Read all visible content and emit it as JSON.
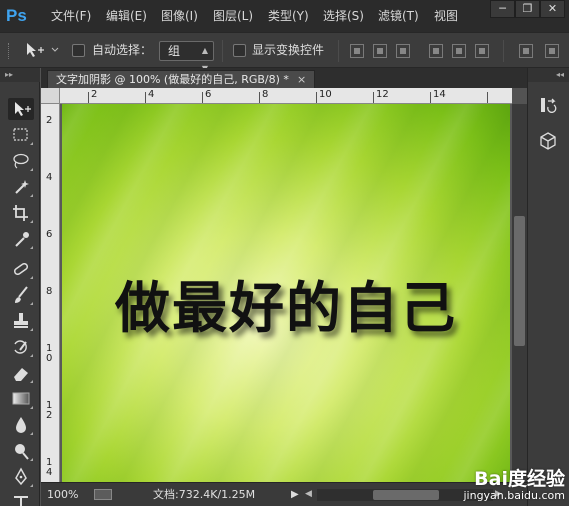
{
  "app": {
    "logo": "Ps"
  },
  "menu": {
    "items": [
      "文件(F)",
      "编辑(E)",
      "图像(I)",
      "图层(L)",
      "类型(Y)",
      "选择(S)",
      "滤镜(T)",
      "视图"
    ]
  },
  "window_controls": {
    "minimize": "─",
    "restore": "❐",
    "close": "✕"
  },
  "options": {
    "auto_select_label": "自动选择：",
    "auto_select_value": "组",
    "show_transform_label": "显示变换控件"
  },
  "document": {
    "tab_title": "文字加阴影 @ 100% (做最好的自己, RGB/8) *",
    "close": "×",
    "canvas_text": "做最好的自己"
  },
  "rulers": {
    "top_labels": [
      "2",
      "4",
      "6",
      "8",
      "10",
      "12",
      "14"
    ],
    "left_labels": [
      "2",
      "4",
      "6",
      "8",
      "10",
      "12",
      "14"
    ]
  },
  "status": {
    "zoom": "100%",
    "doc_info": "文档:732.4K/1.25M"
  },
  "watermark": {
    "logo": "Bai度经验",
    "url": "jingyan.baidu.com"
  },
  "colors": {
    "ps_blue": "#3fa4f0",
    "canvas_green": "#a8d632",
    "ui_dark": "#3c3c3c"
  }
}
